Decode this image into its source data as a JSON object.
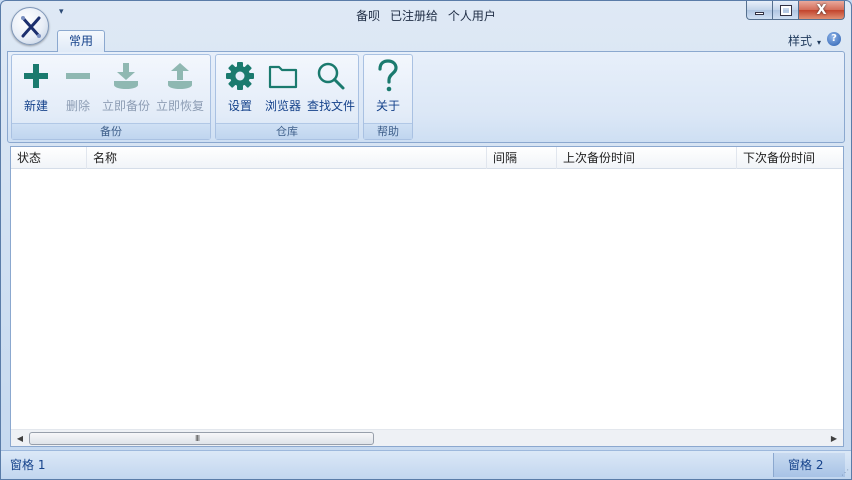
{
  "title": {
    "app_name": "备呗",
    "registered_to": "已注册给",
    "user_type": "个人用户"
  },
  "window_controls": {
    "minimize": "minimize",
    "maximize": "maximize",
    "close": "X"
  },
  "tabs": [
    {
      "label": "常用",
      "active": true
    }
  ],
  "style_menu": {
    "label": "样式",
    "arrow": "▾"
  },
  "help_glyph": "?",
  "ribbon": {
    "groups": [
      {
        "label": "备份",
        "buttons": [
          {
            "label": "新建",
            "icon": "plus-icon",
            "enabled": true
          },
          {
            "label": "删除",
            "icon": "minus-icon",
            "enabled": false
          },
          {
            "label": "立即备份",
            "icon": "download-tray-icon",
            "enabled": false
          },
          {
            "label": "立即恢复",
            "icon": "upload-tray-icon",
            "enabled": false
          }
        ]
      },
      {
        "label": "仓库",
        "buttons": [
          {
            "label": "设置",
            "icon": "gear-icon",
            "enabled": true
          },
          {
            "label": "浏览器",
            "icon": "folder-icon",
            "enabled": true
          },
          {
            "label": "查找文件",
            "icon": "search-icon",
            "enabled": true
          }
        ]
      },
      {
        "label": "帮助",
        "buttons": [
          {
            "label": "关于",
            "icon": "question-icon",
            "enabled": true
          }
        ]
      }
    ]
  },
  "list": {
    "columns": [
      "状态",
      "名称",
      "间隔",
      "上次备份时间",
      "下次备份时间"
    ],
    "rows": []
  },
  "scrollbar": {
    "grip": "III"
  },
  "statusbar": {
    "pane1": "窗格 1",
    "pane2": "窗格 2"
  },
  "colors": {
    "accent": "#1a7a6e",
    "disabled": "#8fb8b2",
    "ribbon_text": "#15428b"
  }
}
